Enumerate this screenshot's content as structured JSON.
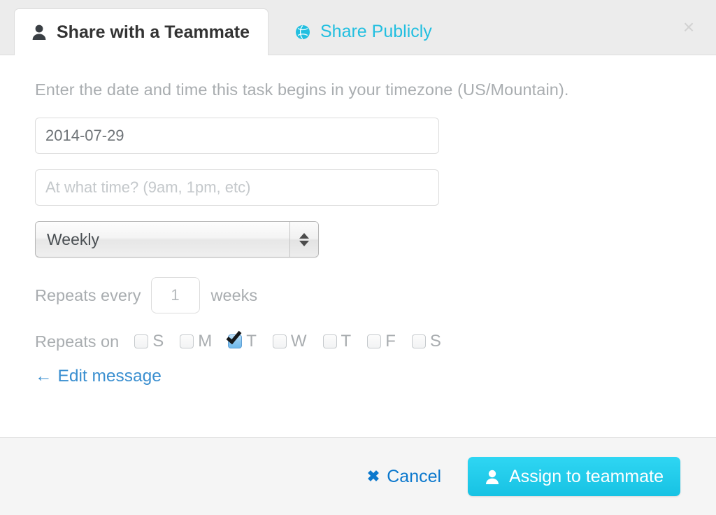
{
  "tabs": [
    {
      "label": "Share with a Teammate",
      "icon": "person-icon",
      "active": true
    },
    {
      "label": "Share Publicly",
      "icon": "globe-icon",
      "active": false
    }
  ],
  "close_label": "×",
  "form": {
    "intro": "Enter the date and time this task begins in your timezone (US/Mountain).",
    "date_value": "2014-07-29",
    "date_placeholder": "",
    "time_value": "",
    "time_placeholder": "At what time? (9am, 1pm, etc)",
    "frequency_selected": "Weekly",
    "frequency_options": [
      "Weekly"
    ],
    "repeats_every_label": "Repeats every",
    "repeats_every_value": "1",
    "repeats_every_unit": "weeks",
    "repeats_on_label": "Repeats on",
    "days": [
      {
        "label": "S",
        "checked": false
      },
      {
        "label": "M",
        "checked": false
      },
      {
        "label": "T",
        "checked": true
      },
      {
        "label": "W",
        "checked": false
      },
      {
        "label": "T",
        "checked": false
      },
      {
        "label": "F",
        "checked": false
      },
      {
        "label": "S",
        "checked": false
      }
    ],
    "edit_message_arrow": "←",
    "edit_message_label": "Edit message"
  },
  "footer": {
    "cancel_icon": "✖",
    "cancel_label": "Cancel",
    "assign_label": "Assign to teammate",
    "assign_icon": "person-icon"
  },
  "colors": {
    "accent_cyan": "#22bfe0",
    "link_blue": "#0b78cd",
    "edit_link_blue": "#3a8fd0",
    "muted_text": "#a9adb0",
    "tabbar_bg": "#ececec",
    "footer_bg": "#f5f5f5",
    "checkbox_checked": "#8cc7f0"
  }
}
